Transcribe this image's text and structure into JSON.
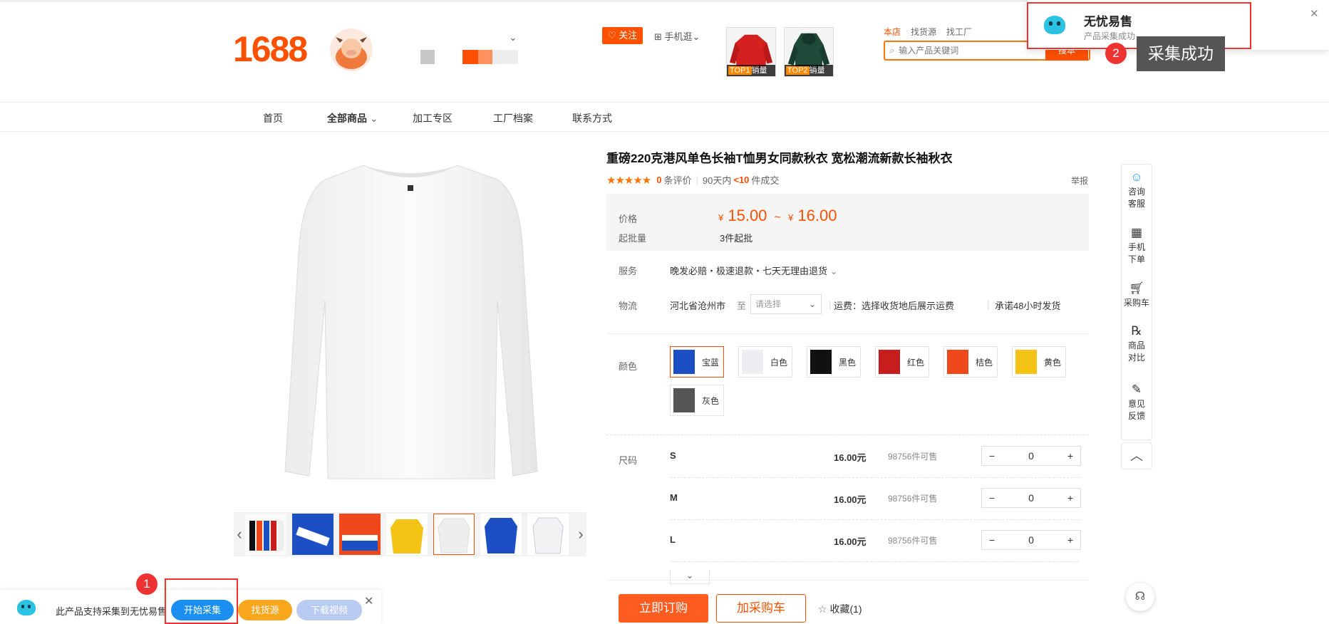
{
  "header": {
    "logo": "1688",
    "follow_label": "关注",
    "follow_icon": "heart-plus-icon",
    "mobile_label": "手机逛",
    "hot": [
      {
        "rank": "TOP1",
        "label": "销量",
        "color": "#d4201f"
      },
      {
        "rank": "TOP2",
        "label": "销量",
        "color": "#1f4a3a"
      }
    ],
    "search_tabs": [
      "本店",
      "找货源",
      "找工厂"
    ],
    "search_placeholder": "输入产品关键词",
    "search_button": "搜本"
  },
  "nav": [
    "首页",
    "全部商品",
    "加工专区",
    "工厂档案",
    "联系方式"
  ],
  "product": {
    "title": "重磅220克港风单色长袖T恤男女同款秋衣 宽松潮流新款长袖秋衣",
    "review_count": "0",
    "review_label": "条评价",
    "sales_prefix": "90天内",
    "sales_value": "<10",
    "sales_suffix": "件成交",
    "report": "举报",
    "price_label": "价格",
    "currency": "¥",
    "price_low": "15.00",
    "price_sep": "~",
    "price_high": "16.00",
    "moq_label": "起批量",
    "moq_value": "3件起批",
    "service_label": "服务",
    "service_value": "晚发必赔・极速退款・七天无理由退货",
    "logistics_label": "物流",
    "origin": "河北省沧州市",
    "to": "至",
    "dest_placeholder": "请选择",
    "freight": "运费：选择收货地后展示运费",
    "ship_promise": "承诺48小时发货",
    "color_label": "颜色",
    "colors": [
      {
        "name": "宝蓝",
        "hex": "#1d4fc4"
      },
      {
        "name": "白色",
        "hex": "#eeeef2"
      },
      {
        "name": "黑色",
        "hex": "#111111"
      },
      {
        "name": "红色",
        "hex": "#c81d1d"
      },
      {
        "name": "桔色",
        "hex": "#f0481a"
      },
      {
        "name": "黄色",
        "hex": "#f3c316"
      },
      {
        "name": "灰色",
        "hex": "#555558"
      }
    ],
    "size_label": "尺码",
    "sizes": [
      {
        "name": "S",
        "price": "16.00元",
        "stock": "98756件可售",
        "qty": "0"
      },
      {
        "name": "M",
        "price": "16.00元",
        "stock": "98756件可售",
        "qty": "0"
      },
      {
        "name": "L",
        "price": "16.00元",
        "stock": "98756件可售",
        "qty": "0"
      }
    ],
    "buy_label": "立即订购",
    "cart_label": "加采购车",
    "fav_label": "收藏(1)"
  },
  "sidebar": [
    {
      "icon": "chat-icon",
      "label": "咨询 客服"
    },
    {
      "icon": "qrcode-icon",
      "label": "手机 下单"
    },
    {
      "icon": "cart-icon",
      "label": "采购车"
    },
    {
      "icon": "compare-icon",
      "label": "商品 对比"
    },
    {
      "icon": "edit-icon",
      "label": "意见 反馈"
    }
  ],
  "plugin": {
    "text": "此产品支持采集到无忧易售",
    "start": "开始采集",
    "find": "找货源",
    "download": "下载视频"
  },
  "toast": {
    "title": "无忧易售",
    "subtitle": "产品采集成功"
  },
  "annotations": {
    "badge1": "1",
    "badge2": "2",
    "tip": "采集成功"
  }
}
